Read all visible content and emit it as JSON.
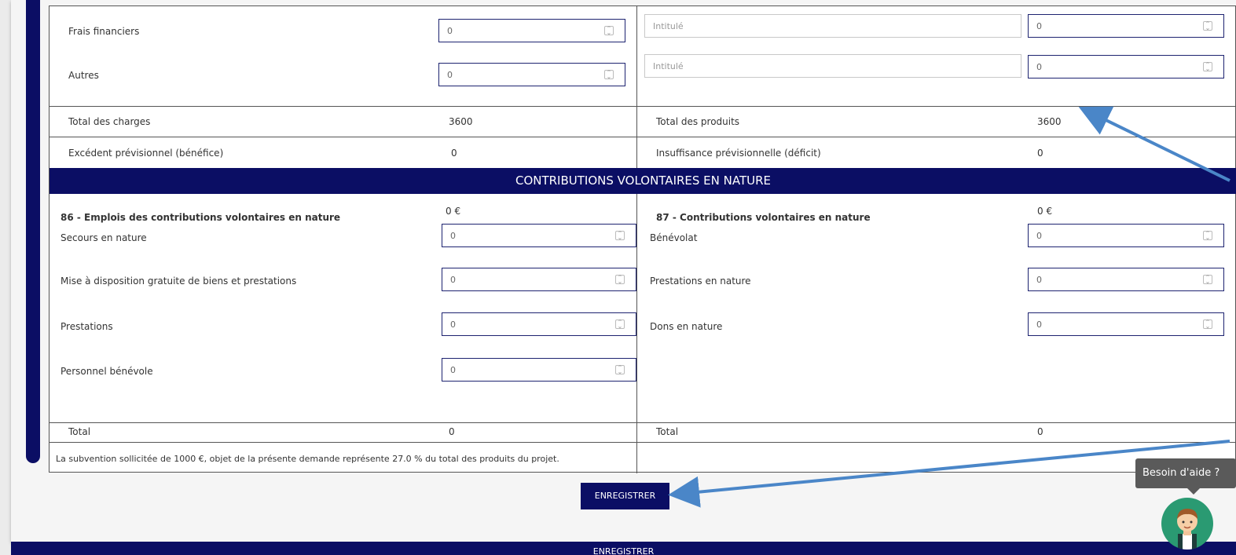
{
  "left_rows": [
    {
      "label": "Frais financiers",
      "value": "0"
    },
    {
      "label": "Autres",
      "value": "0"
    }
  ],
  "right_rows": [
    {
      "placeholder": "Intitulé",
      "value": "0"
    },
    {
      "placeholder": "Intitulé",
      "value": "0"
    }
  ],
  "totals": {
    "charges_label": "Total des charges",
    "charges_value": "3600",
    "produits_label": "Total des produits",
    "produits_value": "3600",
    "excedent_label": "Excédent prévisionnel (bénéfice)",
    "excedent_value": "0",
    "insuffisance_label": "Insuffisance prévisionnelle (déficit)",
    "insuffisance_value": "0"
  },
  "band_title": "CONTRIBUTIONS VOLONTAIRES EN NATURE",
  "cvn_left": {
    "title": "86 - Emplois des contributions volontaires en nature",
    "amount": "0 €",
    "rows": [
      {
        "label": "Secours en nature",
        "value": "0"
      },
      {
        "label": "Mise à disposition gratuite de biens et prestations",
        "value": "0"
      },
      {
        "label": "Prestations",
        "value": "0"
      },
      {
        "label": "Personnel bénévole",
        "value": "0"
      }
    ],
    "total_label": "Total",
    "total_value": "0"
  },
  "cvn_right": {
    "title": "87 - Contributions volontaires en nature",
    "amount": "0 €",
    "rows": [
      {
        "label": "Bénévolat",
        "value": "0"
      },
      {
        "label": "Prestations en nature",
        "value": "0"
      },
      {
        "label": "Dons en nature",
        "value": "0"
      }
    ],
    "total_label": "Total",
    "total_value": "0"
  },
  "note": "La subvention sollicitée de 1000 €, objet de la présente demande représente 27.0 % du total des produits du projet.",
  "save_label": "ENREGISTRER",
  "footer_label": "ENREGISTRER",
  "help": {
    "label": "Besoin d'aide ?",
    "avatar_icon": "user-avatar-icon"
  },
  "colors": {
    "navy": "#0b0e64",
    "annotation_arrow": "#4a86c8",
    "avatar_bg": "#2a9a72"
  }
}
